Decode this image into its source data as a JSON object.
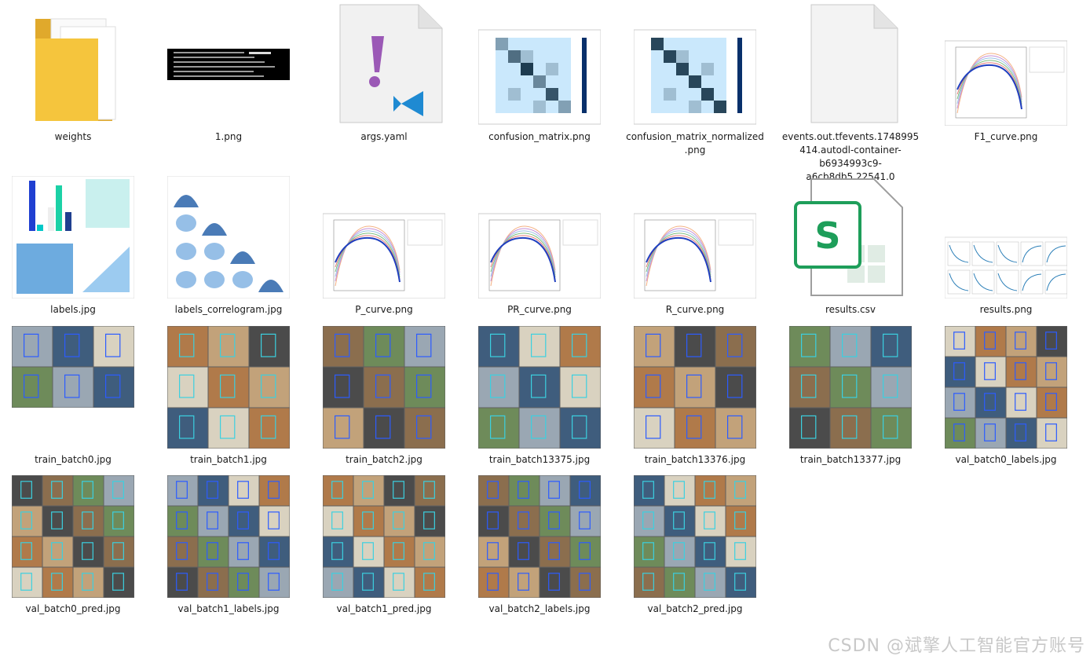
{
  "files": [
    {
      "name": "weights",
      "kind": "folder",
      "icon": "folder-icon"
    },
    {
      "name": "1.png",
      "kind": "image-terminal",
      "icon": "terminal-image-icon"
    },
    {
      "name": "args.yaml",
      "kind": "yaml",
      "icon": "vscode-file-icon"
    },
    {
      "name": "confusion_matrix.png",
      "kind": "image-matrix",
      "icon": "confusion-matrix-thumbnail"
    },
    {
      "name": "confusion_matrix_normalized.png",
      "kind": "image-matrix",
      "icon": "confusion-matrix-thumbnail"
    },
    {
      "name": "events.out.tfevents.1748995414.autodl-container-b6934993c9-a6cb8db5.22541.0",
      "kind": "blank",
      "icon": "blank-file-icon"
    },
    {
      "name": "F1_curve.png",
      "kind": "image-curve",
      "icon": "curve-thumbnail"
    },
    {
      "name": "labels.jpg",
      "kind": "image-labels",
      "icon": "labels-thumbnail"
    },
    {
      "name": "labels_correlogram.jpg",
      "kind": "image-correlogram",
      "icon": "correlogram-thumbnail"
    },
    {
      "name": "P_curve.png",
      "kind": "image-curve",
      "icon": "curve-thumbnail"
    },
    {
      "name": "PR_curve.png",
      "kind": "image-curve",
      "icon": "curve-thumbnail"
    },
    {
      "name": "R_curve.png",
      "kind": "image-curve",
      "icon": "curve-thumbnail"
    },
    {
      "name": "results.csv",
      "kind": "csv",
      "icon": "spreadsheet-icon"
    },
    {
      "name": "results.png",
      "kind": "image-results",
      "icon": "results-thumbnail"
    },
    {
      "name": "train_batch0.jpg",
      "kind": "image-photo",
      "icon": "photo-thumbnail"
    },
    {
      "name": "train_batch1.jpg",
      "kind": "image-photo",
      "icon": "photo-thumbnail"
    },
    {
      "name": "train_batch2.jpg",
      "kind": "image-photo",
      "icon": "photo-thumbnail"
    },
    {
      "name": "train_batch13375.jpg",
      "kind": "image-photo",
      "icon": "photo-thumbnail"
    },
    {
      "name": "train_batch13376.jpg",
      "kind": "image-photo",
      "icon": "photo-thumbnail"
    },
    {
      "name": "train_batch13377.jpg",
      "kind": "image-photo",
      "icon": "photo-thumbnail"
    },
    {
      "name": "val_batch0_labels.jpg",
      "kind": "image-photo",
      "icon": "photo-thumbnail"
    },
    {
      "name": "val_batch0_pred.jpg",
      "kind": "image-photo",
      "icon": "photo-thumbnail"
    },
    {
      "name": "val_batch1_labels.jpg",
      "kind": "image-photo",
      "icon": "photo-thumbnail"
    },
    {
      "name": "val_batch1_pred.jpg",
      "kind": "image-photo",
      "icon": "photo-thumbnail"
    },
    {
      "name": "val_batch2_labels.jpg",
      "kind": "image-photo",
      "icon": "photo-thumbnail"
    },
    {
      "name": "val_batch2_pred.jpg",
      "kind": "image-photo",
      "icon": "photo-thumbnail"
    }
  ],
  "watermark": "CSDN @斌擎人工智能官方账号",
  "colors": {
    "folder": "#f5c53d",
    "vscode_blue": "#1f8ad2",
    "yaml_purple": "#9b59b6",
    "excel_green": "#1e9e5a",
    "matrix_blue": "#08306b"
  }
}
